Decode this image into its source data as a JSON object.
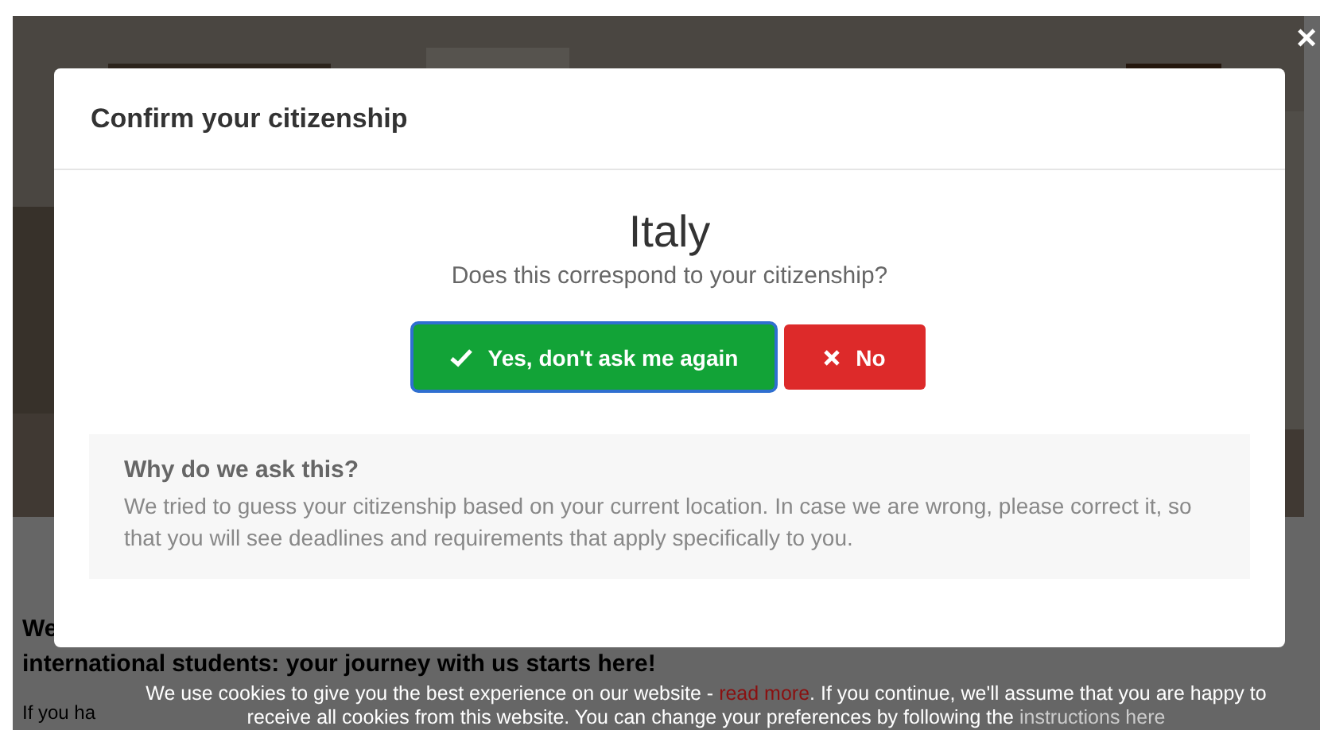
{
  "background_page": {
    "heading_start": "We",
    "heading_line": "international students: your journey with us starts here!",
    "paragraph_start": "If you ha"
  },
  "close_button": {
    "label": "×"
  },
  "dialog": {
    "title": "Confirm your citizenship",
    "country": "Italy",
    "question": "Does this correspond to your citizenship?",
    "buttons": [
      {
        "kind": "confirm",
        "label": "Yes, don't ask me again",
        "focused": true
      },
      {
        "kind": "reject",
        "label": "No",
        "focused": false
      }
    ],
    "info": {
      "title": "Why do we ask this?",
      "text": "We tried to guess your citizenship based on your current location. In case we are wrong, please correct it, so that you will see deadlines and requirements that apply specifically to you."
    }
  },
  "cookie_banner": {
    "text_before": "We use cookies to give you the best experience on our website - ",
    "link": "read more",
    "text_after": ". If you continue, we'll assume that you are happy to receive all cookies from this website. You can change your preferences by following the ",
    "link_2": "instructions here"
  }
}
